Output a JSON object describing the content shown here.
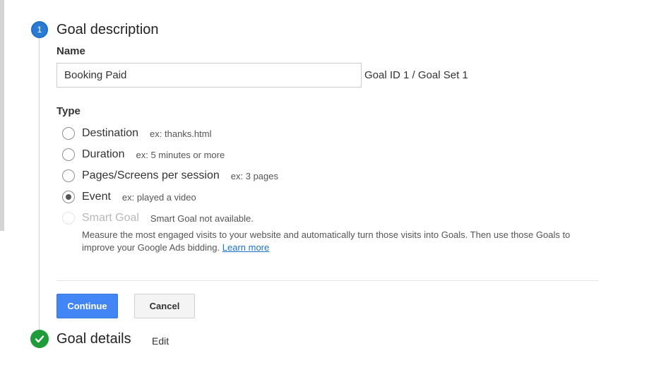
{
  "step1": {
    "number": "1",
    "title": "Goal description",
    "name_label": "Name",
    "name_value": "Booking Paid",
    "goal_id_text": "Goal ID 1 / Goal Set 1",
    "type_label": "Type",
    "options": [
      {
        "label": "Destination",
        "hint": "ex: thanks.html",
        "checked": false,
        "disabled": false
      },
      {
        "label": "Duration",
        "hint": "ex: 5 minutes or more",
        "checked": false,
        "disabled": false
      },
      {
        "label": "Pages/Screens per session",
        "hint": "ex: 3 pages",
        "checked": false,
        "disabled": false
      },
      {
        "label": "Event",
        "hint": "ex: played a video",
        "checked": true,
        "disabled": false
      },
      {
        "label": "Smart Goal",
        "hint": "Smart Goal not available.",
        "checked": false,
        "disabled": true
      }
    ],
    "smart_goal_description": "Measure the most engaged visits to your website and automatically turn those visits into Goals. Then use those Goals to improve your Google Ads bidding.",
    "learn_more_label": "Learn more",
    "continue_label": "Continue",
    "cancel_label": "Cancel"
  },
  "step2": {
    "title": "Goal details",
    "edit_label": "Edit",
    "status_icon": "checkmark-icon"
  },
  "colors": {
    "step_active": "#2a7bd4",
    "step_done": "#1e9c3a",
    "primary_button": "#4285f4",
    "link": "#1a73c8"
  }
}
